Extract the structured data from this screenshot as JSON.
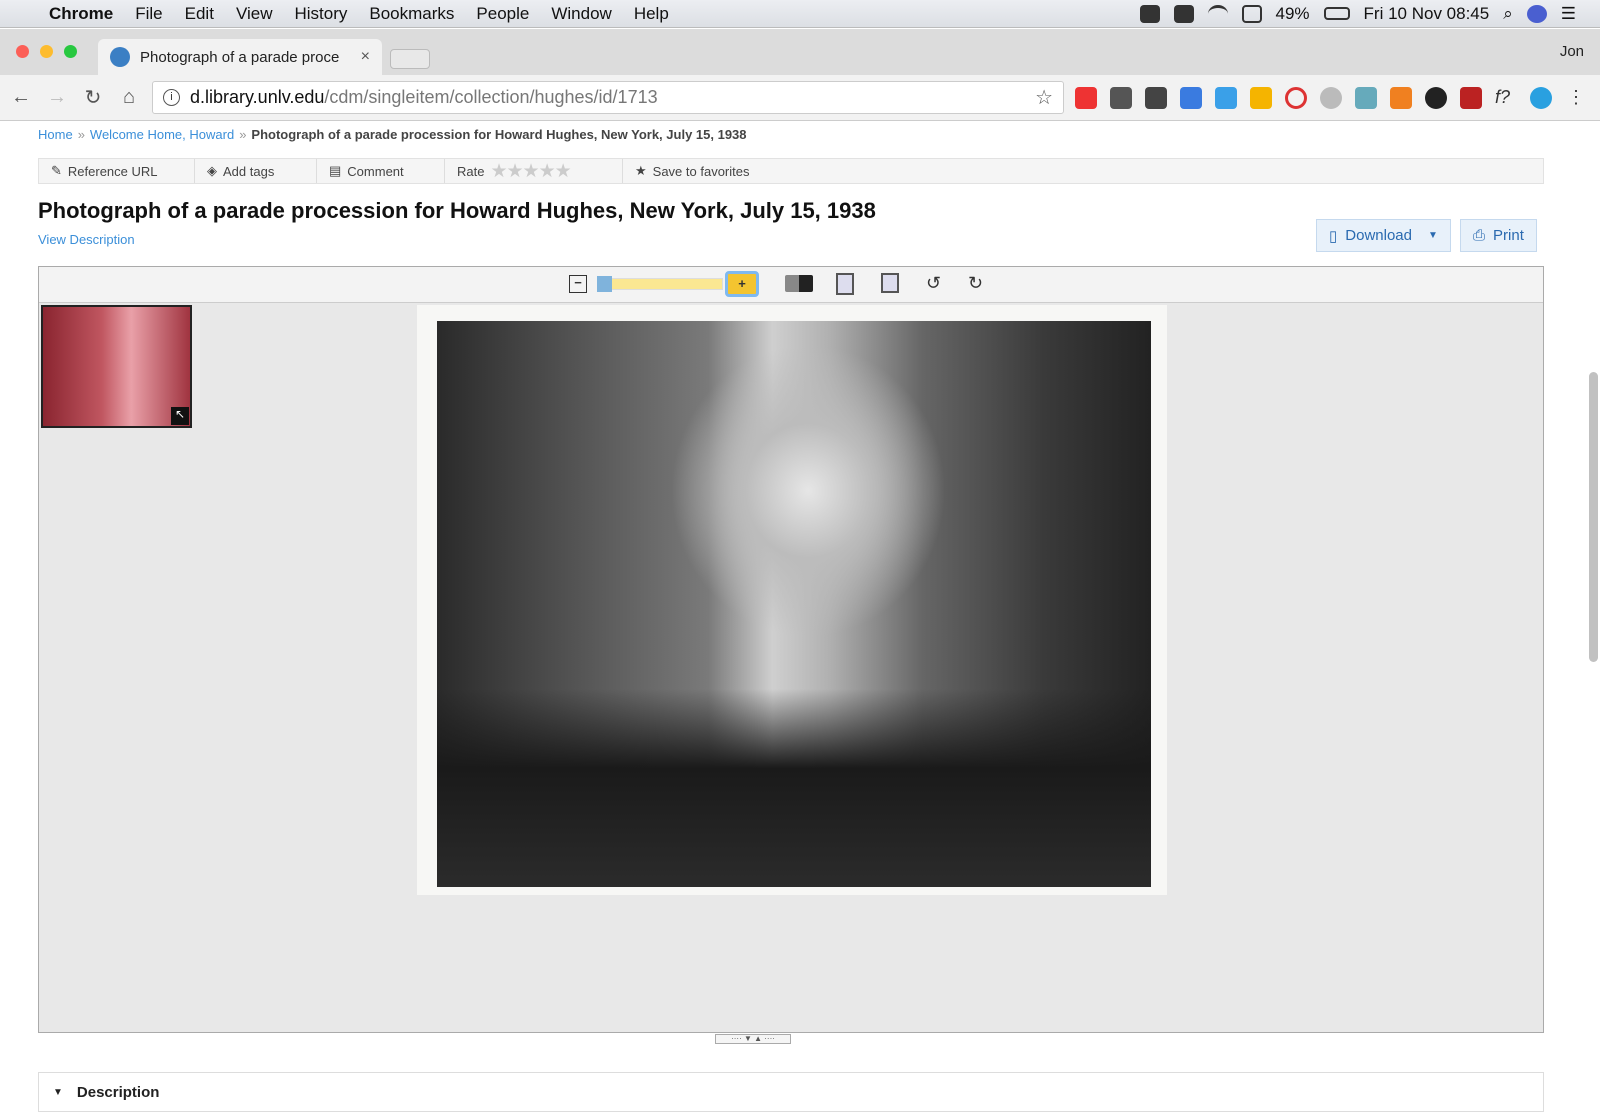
{
  "menubar": {
    "apple": "",
    "app": "Chrome",
    "items": [
      "File",
      "Edit",
      "View",
      "History",
      "Bookmarks",
      "People",
      "Window",
      "Help"
    ],
    "battery": "49%",
    "clock": "Fri 10 Nov  08:45"
  },
  "browser": {
    "tab_title": "Photograph of a parade proce",
    "tab_close": "×",
    "user": "Jon",
    "url_host": "d.library.unlv.edu",
    "url_path": "/cdm/singleitem/collection/hughes/id/1713"
  },
  "breadcrumb": {
    "home": "Home",
    "parent": "Welcome Home, Howard",
    "current": "Photograph of a parade procession for Howard Hughes, New York, July 15, 1938",
    "sep": "»"
  },
  "actions": {
    "reference": "Reference URL",
    "tags": "Add tags",
    "comment": "Comment",
    "rate": "Rate",
    "stars": "★★★★★",
    "favorites": "Save to favorites"
  },
  "title": "Photograph of a parade procession for Howard Hughes, New York, July 15, 1938",
  "view_description": "View Description",
  "download": "Download",
  "print": "Print",
  "viewer": {
    "zoom_fraction": 1.0
  },
  "description_header": "Description"
}
